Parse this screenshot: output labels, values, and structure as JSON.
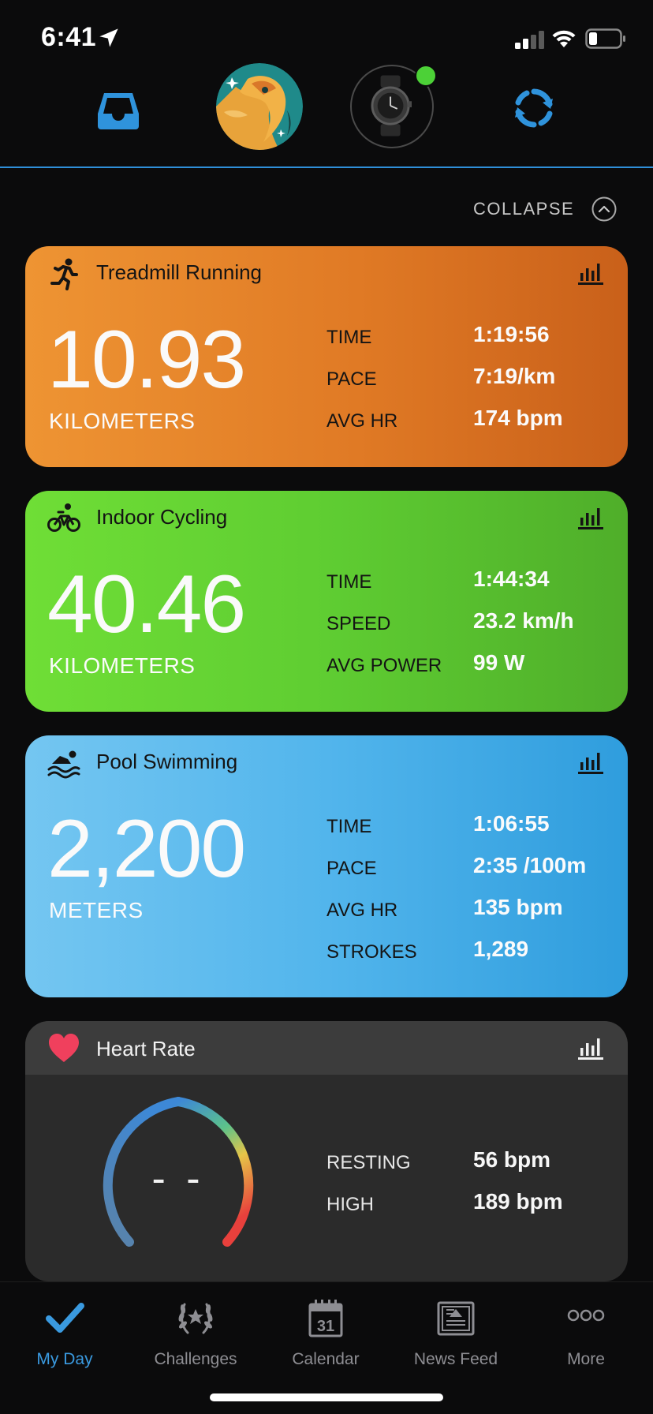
{
  "status_bar": {
    "time": "6:41",
    "icons": [
      "location-arrow-icon",
      "cellular-signal-icon",
      "wifi-icon",
      "battery-icon"
    ]
  },
  "header": {
    "icons": [
      "inbox-icon",
      "avatar",
      "device-watch-icon",
      "sync-icon"
    ],
    "device_status_color": "#4cd137",
    "accent_line_color": "#2f8fd8"
  },
  "collapse": {
    "label": "COLLAPSE",
    "icon": "chevron-up-circle-icon"
  },
  "cards": {
    "treadmill": {
      "title": "Treadmill Running",
      "icon": "runner-icon",
      "value": "10.93",
      "unit": "KILOMETERS",
      "color": "#e8862d",
      "metrics": [
        {
          "label": "TIME",
          "value": "1:19:56"
        },
        {
          "label": "PACE",
          "value": "7:19/km"
        },
        {
          "label": "AVG HR",
          "value": "174 bpm"
        }
      ]
    },
    "cycling": {
      "title": "Indoor Cycling",
      "icon": "bicycle-icon",
      "value": "40.46",
      "unit": "KILOMETERS",
      "color": "#62cf33",
      "metrics": [
        {
          "label": "TIME",
          "value": "1:44:34"
        },
        {
          "label": "SPEED",
          "value": "23.2 km/h"
        },
        {
          "label": "AVG POWER",
          "value": "99 W"
        }
      ]
    },
    "swimming": {
      "title": "Pool Swimming",
      "icon": "swimmer-icon",
      "value": "2,200",
      "unit": "METERS",
      "color": "#4fb3eb",
      "metrics": [
        {
          "label": "TIME",
          "value": "1:06:55"
        },
        {
          "label": "PACE",
          "value": "2:35 /100m"
        },
        {
          "label": "AVG HR",
          "value": "135 bpm"
        },
        {
          "label": "STROKES",
          "value": "1,289"
        }
      ]
    },
    "heart_rate": {
      "title": "Heart Rate",
      "icon": "heart-icon",
      "gauge_value": "- -",
      "metrics": [
        {
          "label": "RESTING",
          "value": "56 bpm"
        },
        {
          "label": "HIGH",
          "value": "189 bpm"
        }
      ]
    }
  },
  "tab_bar": {
    "active": "My Day",
    "active_color": "#3a9ae0",
    "tabs": [
      {
        "label": "My Day",
        "icon": "checkmark-icon"
      },
      {
        "label": "Challenges",
        "icon": "laurel-icon"
      },
      {
        "label": "Calendar",
        "icon": "calendar-icon",
        "badge": "31"
      },
      {
        "label": "News Feed",
        "icon": "newspaper-icon"
      },
      {
        "label": "More",
        "icon": "more-dots-icon"
      }
    ]
  }
}
